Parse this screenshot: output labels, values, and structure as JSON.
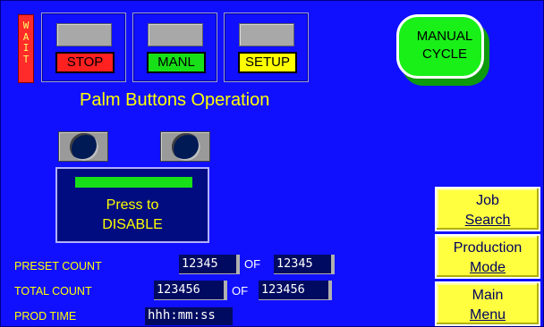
{
  "status": {
    "wait_letters": [
      "W",
      "A",
      "I",
      "T"
    ]
  },
  "mode_buttons": [
    {
      "label": "STOP",
      "color": "#ff2020"
    },
    {
      "label": "MANL",
      "color": "#18e018"
    },
    {
      "label": "SETUP",
      "color": "#ffff00"
    }
  ],
  "manual_cycle": {
    "label_line1": "MANUAL",
    "label_line2": "CYCLE"
  },
  "title": "Palm Buttons Operation",
  "palm_disable": {
    "line1": "Press to",
    "line2": "DISABLE"
  },
  "side_menu": {
    "job_search": {
      "line1": "Job",
      "line2": "Search"
    },
    "production_mode": {
      "line1": "Production",
      "line2": "Mode"
    },
    "main_menu": {
      "line1": "Main",
      "line2": "Menu"
    }
  },
  "counts": {
    "preset_label": "PRESET COUNT",
    "preset_value": "12345",
    "preset_of": "OF",
    "preset_target": "12345",
    "total_label": "TOTAL COUNT",
    "total_value": "123456",
    "total_of": "OF",
    "total_target": "123456",
    "prod_time_label": "PROD TIME",
    "prod_time_value": "hhh:mm:ss"
  },
  "colors": {
    "background": "#1010ff",
    "accent_text": "#ffff00",
    "indicator_green": "#18e018",
    "button_yellow": "#ffff40"
  }
}
